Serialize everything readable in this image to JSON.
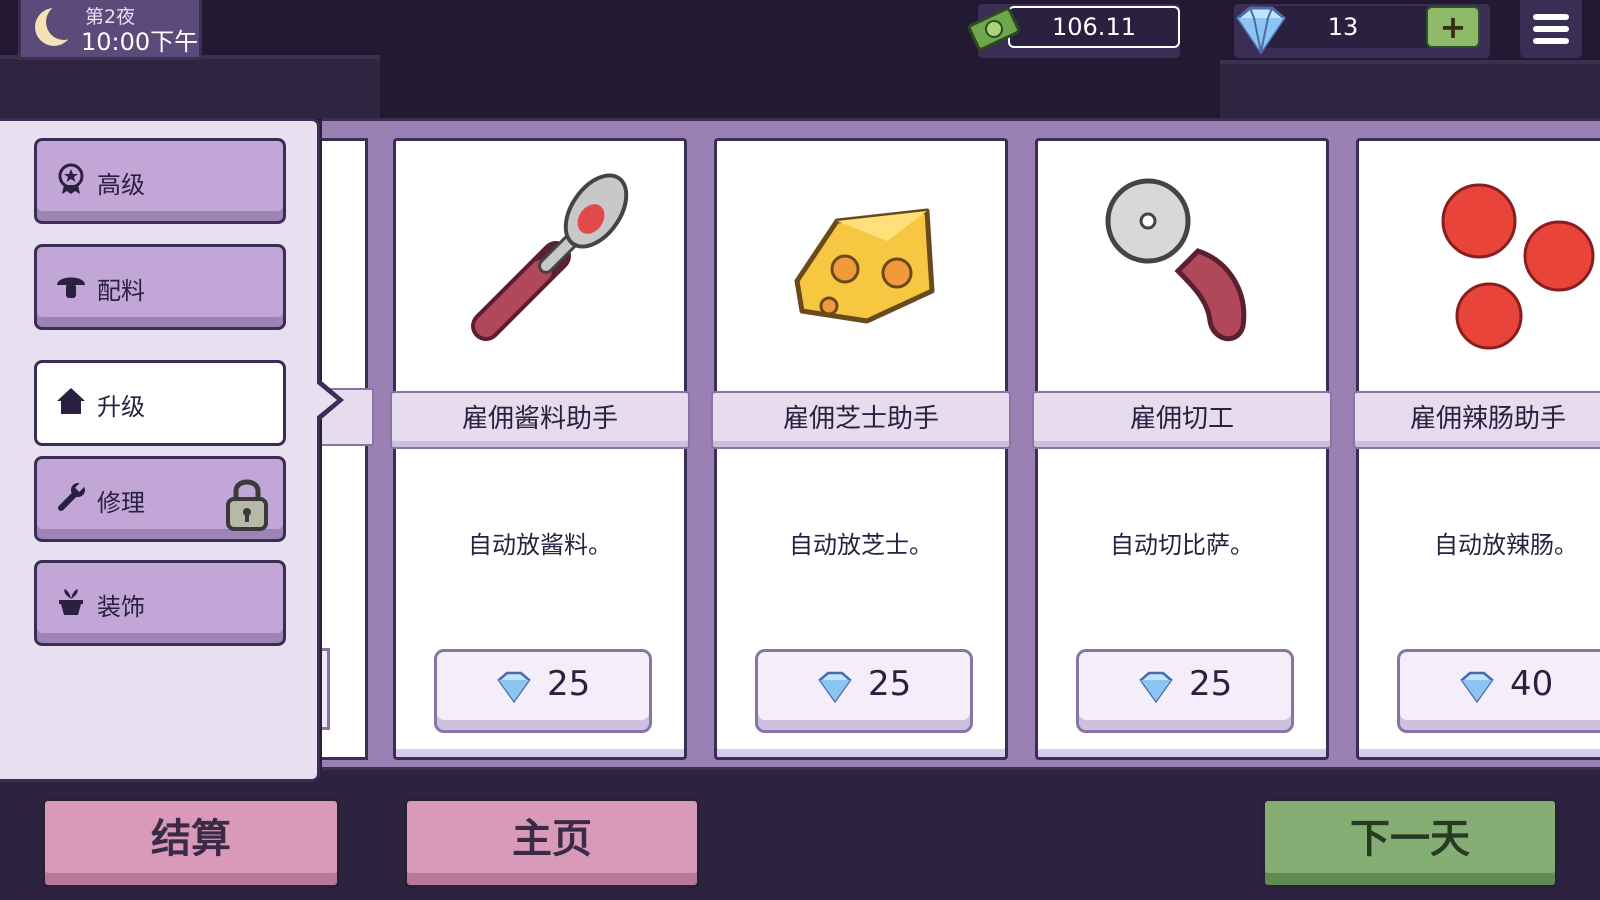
{
  "hud": {
    "night": "第2夜",
    "time": "10:00下午",
    "money": "106.11",
    "gems": "13",
    "add_gems": "+"
  },
  "sidebar": {
    "items": [
      {
        "label": "高级",
        "icon": "badge-star-icon",
        "active": false,
        "locked": false
      },
      {
        "label": "配料",
        "icon": "mushroom-icon",
        "active": false,
        "locked": false
      },
      {
        "label": "升级",
        "icon": "house-icon",
        "active": true,
        "locked": false
      },
      {
        "label": "修理",
        "icon": "wrench-icon",
        "active": false,
        "locked": true
      },
      {
        "label": "装饰",
        "icon": "plant-pot-icon",
        "active": false,
        "locked": false
      }
    ]
  },
  "cards": [
    {
      "title": "雇佣酱料助手",
      "desc": "自动放酱料。",
      "price": "25",
      "art": "sauce-spoon-icon"
    },
    {
      "title": "雇佣芝士助手",
      "desc": "自动放芝士。",
      "price": "25",
      "art": "cheese-icon"
    },
    {
      "title": "雇佣切工",
      "desc": "自动切比萨。",
      "price": "25",
      "art": "pizza-cutter-icon"
    },
    {
      "title": "雇佣辣肠助手",
      "desc": "自动放辣肠。",
      "price": "40",
      "art": "pepperoni-icon"
    }
  ],
  "footer": {
    "settle": "结算",
    "home": "主页",
    "next_day": "下一天"
  },
  "colors": {
    "tab_bg": "#c2a6d8",
    "tab_active_bg": "#ffffff",
    "pink_button": "#d89ab8",
    "green_button": "#84ae74",
    "card_strip": "#9a80b3"
  }
}
